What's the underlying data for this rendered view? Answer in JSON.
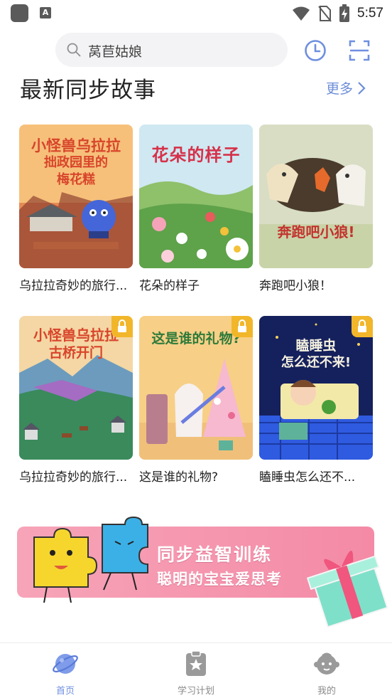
{
  "status_bar": {
    "time": "5:57",
    "icons": [
      "app-icon",
      "a-icon",
      "wifi-icon",
      "no-sim-icon",
      "battery-charging-icon"
    ]
  },
  "search": {
    "placeholder": "莴苣姑娘",
    "icon": "search-icon"
  },
  "header_actions": [
    "history-clock-icon",
    "scan-icon"
  ],
  "section": {
    "title": "最新同步故事",
    "more_label": "更多"
  },
  "books": [
    {
      "title": "乌拉拉奇妙的旅行...",
      "cover_text": [
        "小怪兽乌拉拉",
        "拙政园里的",
        "梅花糕"
      ],
      "locked": false
    },
    {
      "title": "花朵的样子",
      "cover_text": [
        "花朵的样子"
      ],
      "locked": false
    },
    {
      "title": "奔跑吧小狼！",
      "cover_text": [
        "奔跑吧小狼!"
      ],
      "locked": false
    },
    {
      "title": "乌拉拉奇妙的旅行...",
      "cover_text": [
        "小怪兽乌拉拉",
        "古桥开门"
      ],
      "locked": true
    },
    {
      "title": "这是谁的礼物?",
      "cover_text": [
        "这是谁的礼物?"
      ],
      "locked": true
    },
    {
      "title": "瞌睡虫怎么还不...",
      "cover_text": [
        "瞌睡虫",
        "怎么还不来!"
      ],
      "locked": true
    }
  ],
  "banner": {
    "line1": "同步益智训练",
    "line2": "聪明的宝宝爱思考"
  },
  "bottom_nav": [
    {
      "label": "首页",
      "icon": "planet-icon",
      "active": true
    },
    {
      "label": "学习计划",
      "icon": "study-plan-icon",
      "active": false
    },
    {
      "label": "我的",
      "icon": "baby-face-icon",
      "active": false
    }
  ],
  "colors": {
    "accent": "#6f8fe0",
    "lock": "#f2b62a",
    "banner": "#f48aa6"
  }
}
